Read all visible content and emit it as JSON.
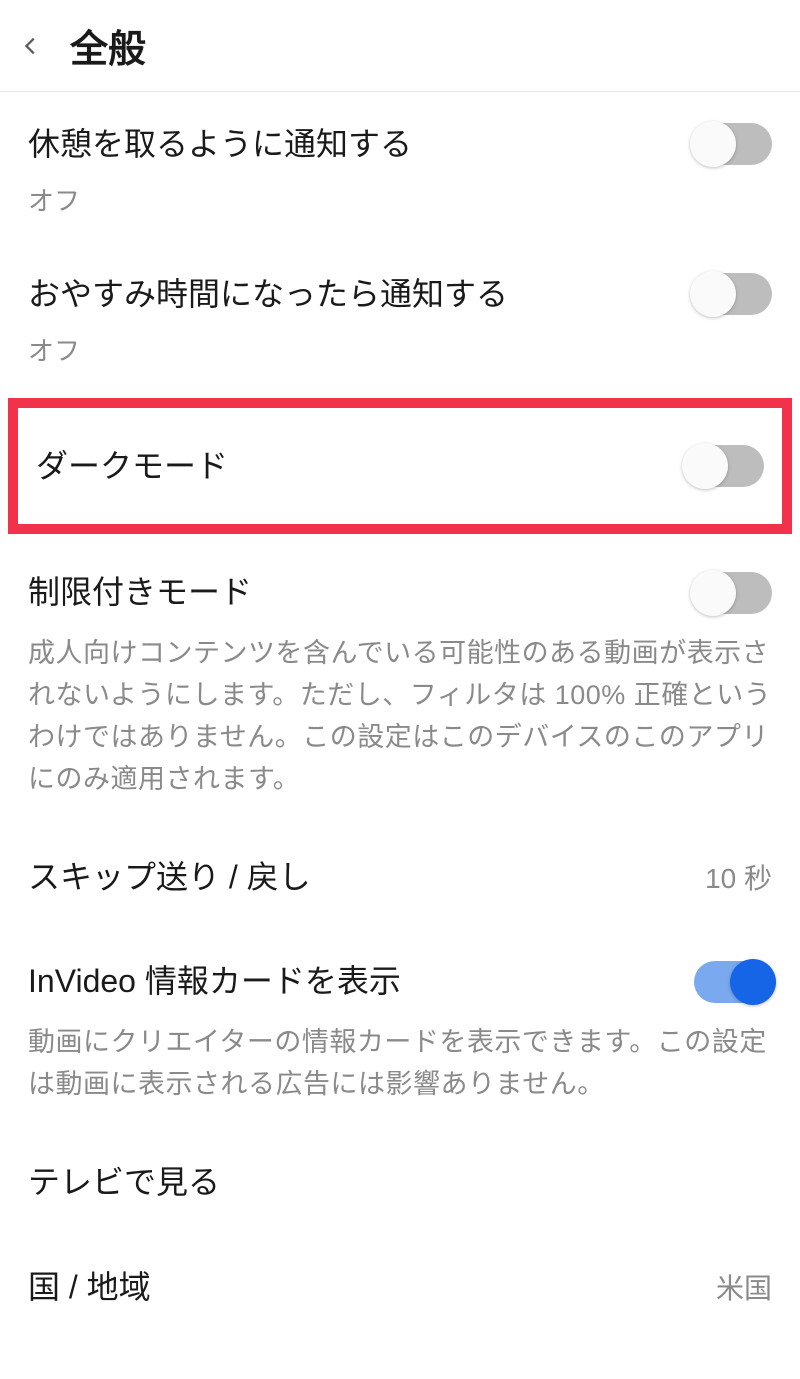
{
  "header": {
    "title": "全般"
  },
  "settings": {
    "break_reminder": {
      "label": "休憩を取るように通知する",
      "sublabel": "オフ"
    },
    "bedtime_reminder": {
      "label": "おやすみ時間になったら通知する",
      "sublabel": "オフ"
    },
    "dark_mode": {
      "label": "ダークモード"
    },
    "restricted_mode": {
      "label": "制限付きモード",
      "description": "成人向けコンテンツを含んでいる可能性のある動画が表示されないようにします。ただし、フィルタは 100% 正確というわけではありません。この設定はこのデバイスのこのアプリにのみ適用されます。"
    },
    "skip": {
      "label": "スキップ送り / 戻し",
      "value": "10 秒"
    },
    "invideo": {
      "label": "InVideo 情報カードを表示",
      "description": "動画にクリエイターの情報カードを表示できます。この設定は動画に表示される広告には影響ありません。"
    },
    "watch_tv": {
      "label": "テレビで見る"
    },
    "country": {
      "label": "国 / 地域",
      "value": "米国"
    }
  }
}
